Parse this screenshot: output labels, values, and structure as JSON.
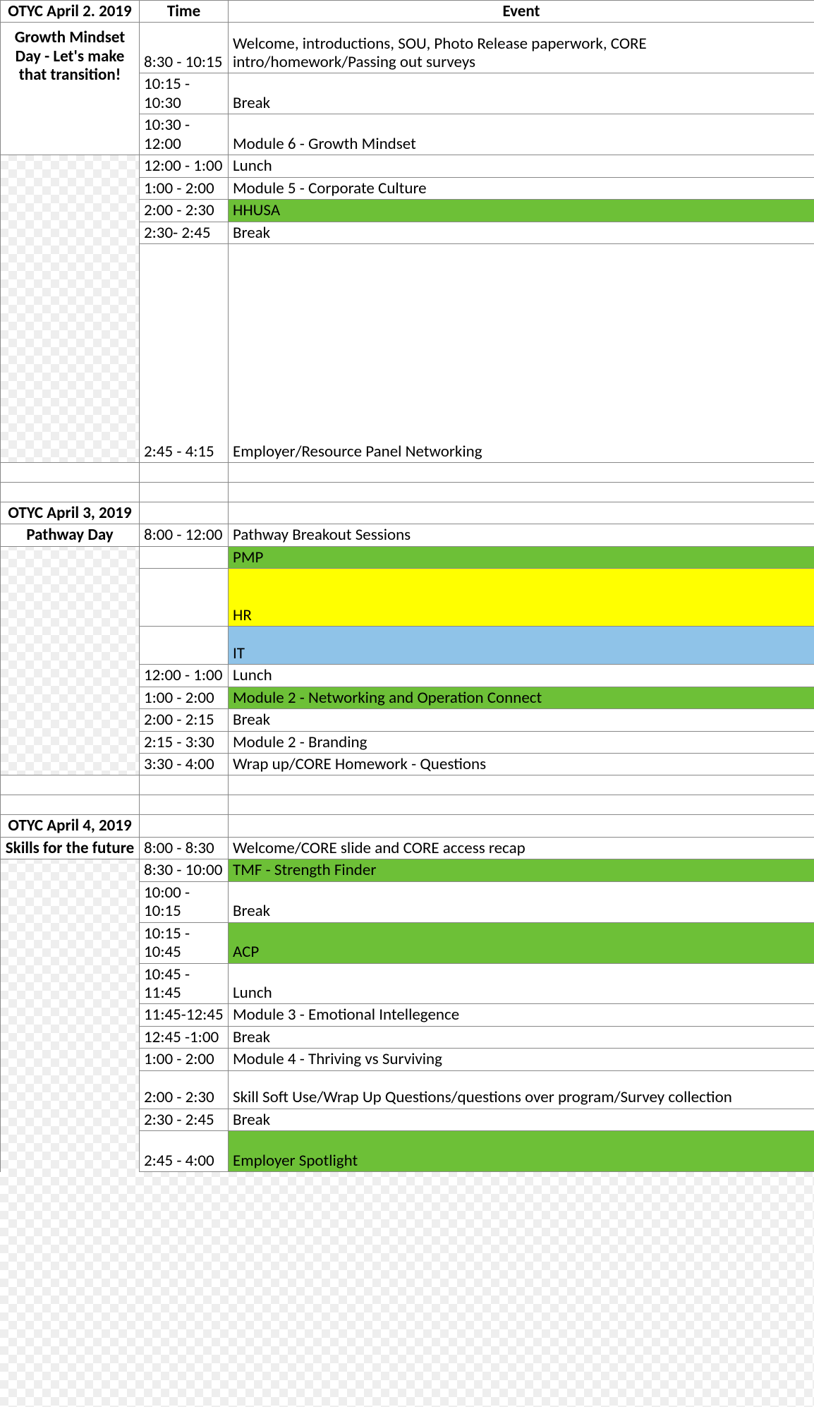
{
  "headers": {
    "day": "OTYC April 2. 2019",
    "time": "Time",
    "event": "Event"
  },
  "day1": {
    "title": "Growth Mindset Day - Let's make that transition!",
    "rows": [
      {
        "time": "8:30 - 10:15",
        "event": "Welcome, introductions, SOU, Photo Release paperwork, CORE intro/homework/Passing out surveys"
      },
      {
        "time": "10:15 - 10:30",
        "event": "Break"
      },
      {
        "time": "10:30 - 12:00",
        "event": "Module 6 - Growth Mindset"
      },
      {
        "time": "12:00 - 1:00",
        "event": "Lunch"
      },
      {
        "time": "1:00 - 2:00",
        "event": "Module 5 - Corporate Culture"
      },
      {
        "time": "2:00 - 2:30",
        "event": "HHUSA",
        "color": "green"
      },
      {
        "time": "2:30- 2:45",
        "event": "Break"
      },
      {
        "time": "2:45 - 4:15",
        "event": "Employer/Resource Panel Networking",
        "tall": true
      }
    ]
  },
  "day2": {
    "date": "OTYC April 3, 2019",
    "title": "Pathway Day",
    "rows": [
      {
        "time": "8:00 - 12:00",
        "event": "Pathway Breakout Sessions"
      },
      {
        "time": "",
        "event": "PMP",
        "color": "green"
      },
      {
        "time": "",
        "event": "HR",
        "color": "yellow",
        "tall": true
      },
      {
        "time": "",
        "event": "IT",
        "color": "blue",
        "tall2": true
      },
      {
        "time": "12:00 - 1:00",
        "event": "Lunch"
      },
      {
        "time": "1:00 - 2:00",
        "event": "Module 2 - Networking and Operation Connect",
        "color": "green"
      },
      {
        "time": "2:00 - 2:15",
        "event": "Break"
      },
      {
        "time": "2:15 - 3:30",
        "event": "Module 2 - Branding"
      },
      {
        "time": "3:30 - 4:00",
        "event": "Wrap up/CORE Homework - Questions"
      }
    ]
  },
  "day3": {
    "date": "OTYC April 4, 2019",
    "title": "Skills for the future",
    "rows": [
      {
        "time": "8:00 - 8:30",
        "event": "Welcome/CORE slide and CORE access recap"
      },
      {
        "time": "8:30 - 10:00",
        "event": "TMF - Strength Finder",
        "color": "green"
      },
      {
        "time": "10:00 - 10:15",
        "event": "Break"
      },
      {
        "time": "10:15 - 10:45",
        "event": "ACP",
        "color": "green"
      },
      {
        "time": "10:45 - 11:45",
        "event": "Lunch"
      },
      {
        "time": "11:45-12:45",
        "event": "Module 3 - Emotional Intellegence"
      },
      {
        "time": "12:45 -1:00",
        "event": "Break"
      },
      {
        "time": "1:00 - 2:00",
        "event": "Module 4 - Thriving vs Surviving"
      },
      {
        "time": "2:00 - 2:30",
        "event": "Skill Soft Use/Wrap Up Questions/questions over program/Survey collection"
      },
      {
        "time": "2:30 - 2:45",
        "event": "Break"
      },
      {
        "time": "2:45 - 4:00",
        "event": "Employer Spotlight",
        "color": "green",
        "tall2": true
      }
    ]
  }
}
